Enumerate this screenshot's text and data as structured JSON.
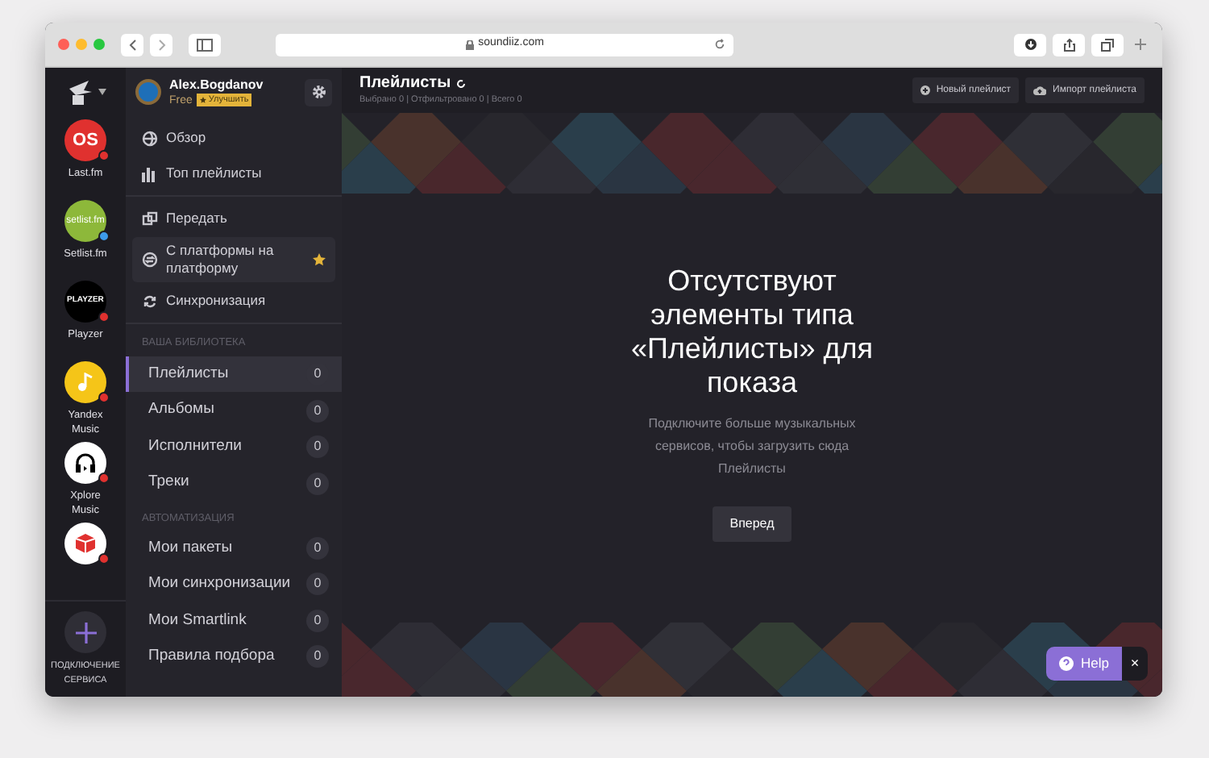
{
  "browser": {
    "address": "soundiiz.com"
  },
  "services": [
    {
      "name": "Last.fm",
      "logo": "OS",
      "kind": "lastfm",
      "color": "#e0312f"
    },
    {
      "name": "Setlist.fm",
      "logo": "setlist.fm",
      "kind": "setlist",
      "color": "#3d9be9"
    },
    {
      "name": "Playzer",
      "logo": "PLAYZER",
      "kind": "playzer",
      "color": "#e0312f"
    },
    {
      "name": "Yandex Music",
      "kind": "yandex",
      "color": "#e0312f"
    },
    {
      "name": "Xplore Music",
      "kind": "xplore",
      "color": "#e0312f"
    },
    {
      "kind": "other",
      "color": "#e0312f"
    }
  ],
  "add_service": {
    "label": "ПОДКЛЮЧЕНИЕ СЕРВИСА"
  },
  "profile": {
    "name": "Alex.Bogdanov",
    "plan": "Free",
    "upgrade": "Улучшить"
  },
  "nav_groups": [
    [
      {
        "label": "Обзор",
        "kind": "globe",
        "highlighted": false
      },
      {
        "label": "Топ плейлисты",
        "kind": "chart",
        "highlighted": false
      }
    ],
    [
      {
        "label": "Передать",
        "kind": "transfer",
        "highlighted": false
      },
      {
        "label": "С платформы на платформу",
        "kind": "platform",
        "highlighted": true
      },
      {
        "label": "Синхронизация",
        "kind": "sync",
        "highlighted": false
      }
    ]
  ],
  "library": {
    "title": "ВАША БИБЛИОТЕКА",
    "items": [
      {
        "label": "Плейлисты",
        "count": "0",
        "selected": true
      },
      {
        "label": "Альбомы",
        "count": "0",
        "selected": false
      },
      {
        "label": "Исполнители",
        "count": "0",
        "selected": false
      },
      {
        "label": "Треки",
        "count": "0",
        "selected": false
      }
    ]
  },
  "automation": {
    "title": "АВТОМАТИЗАЦИЯ",
    "items": [
      {
        "label": "Мои пакеты",
        "count": "0",
        "selected": false
      },
      {
        "label": "Мои синхронизации",
        "count": "0",
        "selected": false
      },
      {
        "label": "Мои Smartlink",
        "count": "0",
        "selected": false
      },
      {
        "label": "Правила подбора",
        "count": "0",
        "selected": false
      }
    ]
  },
  "header": {
    "title": "Плейлисты",
    "stats": "Выбрано 0 | Отфильтровано 0 | Всего 0",
    "buttons": [
      {
        "label": "Новый плейлист",
        "kind": "new"
      },
      {
        "label": "Импорт плейлиста",
        "kind": "import"
      }
    ]
  },
  "empty_state": {
    "title": "Отсутствуют элементы типа «Плейлисты» для показа",
    "text": "Подключите больше музыкальных сервисов, чтобы загрузить сюда Плейлисты",
    "button": "Вперед"
  },
  "help": {
    "label": "Help",
    "close": "×"
  }
}
